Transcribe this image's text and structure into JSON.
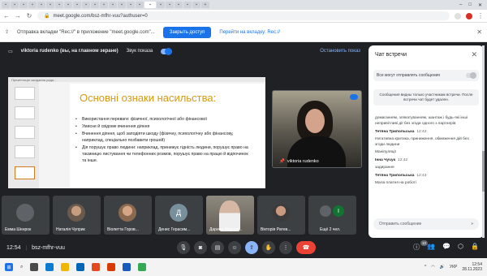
{
  "browser": {
    "url": "meet.google.com/bsz-mfhr-vuu?authuser=0"
  },
  "notification": {
    "text": "Отправка вкладки \"Rec://\" в приложение \"meet.google.com\"...",
    "allow": "Закрыть доступ",
    "switch": "Перейти на вкладку: Rec://"
  },
  "presenting": {
    "name": "viktoria rudenko (вы, на главном экране)",
    "sound_label": "Звук показа",
    "stop": "Остановить показ"
  },
  "slide": {
    "window_title": "Презентація засідання ради...",
    "title": "Основні ознаки насильства:",
    "bullets": [
      "Використання переваги: фізичної, психологічної або фінансової",
      "Умисне й свідоме вчинення діяння",
      "Вчинення діяння, щоб заподіяти шкоду (фізичну, психологічну або фінансову, наприклад, спеціально позбавити грошей)",
      "Дія порушує право людини: наприклад, принижує гідність людини, порушує право на таємницю листування чи телефонних розмов, порушує право на працю й відпочинок та інше."
    ]
  },
  "self_tile": {
    "name": "viktoria rudenko"
  },
  "participants": [
    {
      "name": "Емма Шенрок",
      "initial": ""
    },
    {
      "name": "Наталія Чуприк",
      "initial": ""
    },
    {
      "name": "Віолетта Горов...",
      "initial": ""
    },
    {
      "name": "Денис Герасим...",
      "initial": "Д"
    },
    {
      "name": "Дарина Марчев...",
      "initial": ""
    },
    {
      "name": "Вікторія Ратев...",
      "initial": ""
    },
    {
      "name": "Ещё 2 чел.",
      "initial": "І"
    }
  ],
  "chat": {
    "title": "Чат встречи",
    "perm_label": "Все могут отправлять сообщения",
    "info": "Сообщения видны только участникам встречи. После встречи чат будет удален.",
    "messages": [
      {
        "sender": "",
        "time": "",
        "text": "домаганням, злякатуванням, шантаж і будь-які інші непривітливі дії без згоди одного з партнерів"
      },
      {
        "sender": "Тетяна Трипольська",
        "time": "12:42",
        "text": "Негативна критика, приниження, обмеження дій без згоди людини"
      },
      {
        "sender": "",
        "time": "",
        "text": "Маніпуляції"
      },
      {
        "sender": "Інна Чучук",
        "time": "12:42",
        "text": "задирання"
      },
      {
        "sender": "Тетяна Трипольська",
        "time": "12:43",
        "text": "Мала платня на роботі"
      }
    ],
    "input_placeholder": "Отправить сообщение"
  },
  "controls": {
    "time": "12:54",
    "code": "bsz-mfhr-vuu",
    "participant_count": "10"
  },
  "taskbar": {
    "lang": "УКР",
    "time": "12:54",
    "date": "28.11.2023"
  }
}
